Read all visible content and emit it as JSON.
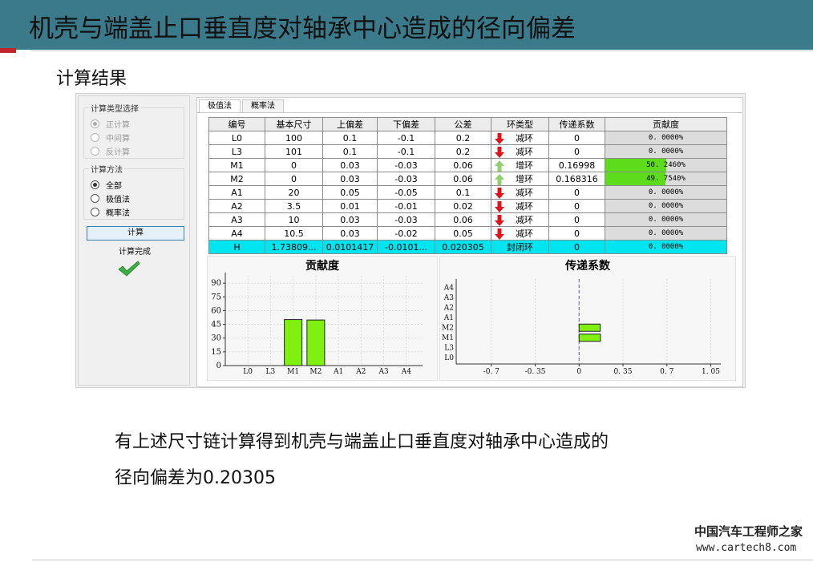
{
  "slide": {
    "title": "机壳与端盖止口垂直度对轴承中心造成的径向偏差",
    "subtitle": "计算结果",
    "body_line1": "有上述尺寸链计算得到机壳与端盖止口垂直度对轴承中心造成的",
    "body_line2": "径向偏差为0.20305",
    "watermark_cn": "中国汽车工程师之家",
    "watermark_url": "www.cartech8.com"
  },
  "left_panel": {
    "calc_type_group": "计算类型选择",
    "calc_types": [
      "正计算",
      "中间算",
      "反计算"
    ],
    "calc_type_selected": 0,
    "method_group": "计算方法",
    "methods": [
      "全部",
      "极值法",
      "概率法"
    ],
    "method_selected": 0,
    "calc_button": "计算",
    "status": "计算完成"
  },
  "tabs": [
    "极值法",
    "概率法"
  ],
  "table": {
    "headers": [
      "编号",
      "基本尺寸",
      "上偏差",
      "下偏差",
      "公差",
      "环类型",
      "传递系数",
      "贡献度"
    ],
    "rows": [
      {
        "id": "L0",
        "base": "100",
        "upper": "0.1",
        "lower": "-0.1",
        "tol": "0.2",
        "type": "减环",
        "dir": "down",
        "coef": "0",
        "contrib": "0. 0000%",
        "pct": 0
      },
      {
        "id": "L3",
        "base": "101",
        "upper": "0.1",
        "lower": "-0.1",
        "tol": "0.2",
        "type": "减环",
        "dir": "down",
        "coef": "0",
        "contrib": "0. 0000%",
        "pct": 0
      },
      {
        "id": "M1",
        "base": "0",
        "upper": "0.03",
        "lower": "-0.03",
        "tol": "0.06",
        "type": "增环",
        "dir": "up",
        "coef": "0.16998",
        "contrib": "50. 2460%",
        "pct": 50.246
      },
      {
        "id": "M2",
        "base": "0",
        "upper": "0.03",
        "lower": "-0.03",
        "tol": "0.06",
        "type": "增环",
        "dir": "up",
        "coef": "0.168316",
        "contrib": "49. 7540%",
        "pct": 49.754
      },
      {
        "id": "A1",
        "base": "20",
        "upper": "0.05",
        "lower": "-0.05",
        "tol": "0.1",
        "type": "减环",
        "dir": "down",
        "coef": "0",
        "contrib": "0. 0000%",
        "pct": 0
      },
      {
        "id": "A2",
        "base": "3.5",
        "upper": "0.01",
        "lower": "-0.01",
        "tol": "0.02",
        "type": "减环",
        "dir": "down",
        "coef": "0",
        "contrib": "0. 0000%",
        "pct": 0
      },
      {
        "id": "A3",
        "base": "10",
        "upper": "0.03",
        "lower": "-0.03",
        "tol": "0.06",
        "type": "减环",
        "dir": "down",
        "coef": "0",
        "contrib": "0. 0000%",
        "pct": 0
      },
      {
        "id": "A4",
        "base": "10.5",
        "upper": "0.03",
        "lower": "-0.02",
        "tol": "0.05",
        "type": "减环",
        "dir": "down",
        "coef": "0",
        "contrib": "0. 0000%",
        "pct": 0
      }
    ],
    "closing": {
      "id": "H",
      "base": "1.73809...",
      "upper": "0.0101417",
      "lower": "-0.0101...",
      "tol": "0.020305",
      "type": "封闭环",
      "coef": "0",
      "contrib": "0. 0000%"
    }
  },
  "colors": {
    "title_bar": "#3a7a8a",
    "closing_row": "#00e5ef",
    "contrib_fill": "#5ddc1b",
    "bar_fill": "#7ff00f",
    "arrow_down": "#e0141b",
    "arrow_up": "#8fd26a"
  },
  "chart_data": [
    {
      "type": "bar",
      "title": "贡献度",
      "categories": [
        "L0",
        "L3",
        "M1",
        "M2",
        "A1",
        "A2",
        "A3",
        "A4"
      ],
      "values": [
        0,
        0,
        50.246,
        49.754,
        0,
        0,
        0,
        0
      ],
      "yticks": [
        0,
        15,
        30,
        45,
        60,
        75,
        90
      ],
      "ylim": [
        0,
        98
      ],
      "grid": true
    },
    {
      "type": "bar",
      "orientation": "horizontal",
      "title": "传递系数",
      "categories": [
        "L0",
        "L3",
        "M1",
        "M2",
        "A1",
        "A2",
        "A3",
        "A4"
      ],
      "values": [
        0,
        0,
        0.16998,
        0.168316,
        0,
        0,
        0,
        0
      ],
      "xticks": [
        "-0. 7",
        "-0. 35",
        "0",
        "0. 35",
        "0. 7",
        "1. 05"
      ],
      "xtick_values": [
        -0.7,
        -0.35,
        0,
        0.35,
        0.7,
        1.05
      ],
      "xlim": [
        -0.98,
        1.13
      ],
      "grid": true
    }
  ]
}
